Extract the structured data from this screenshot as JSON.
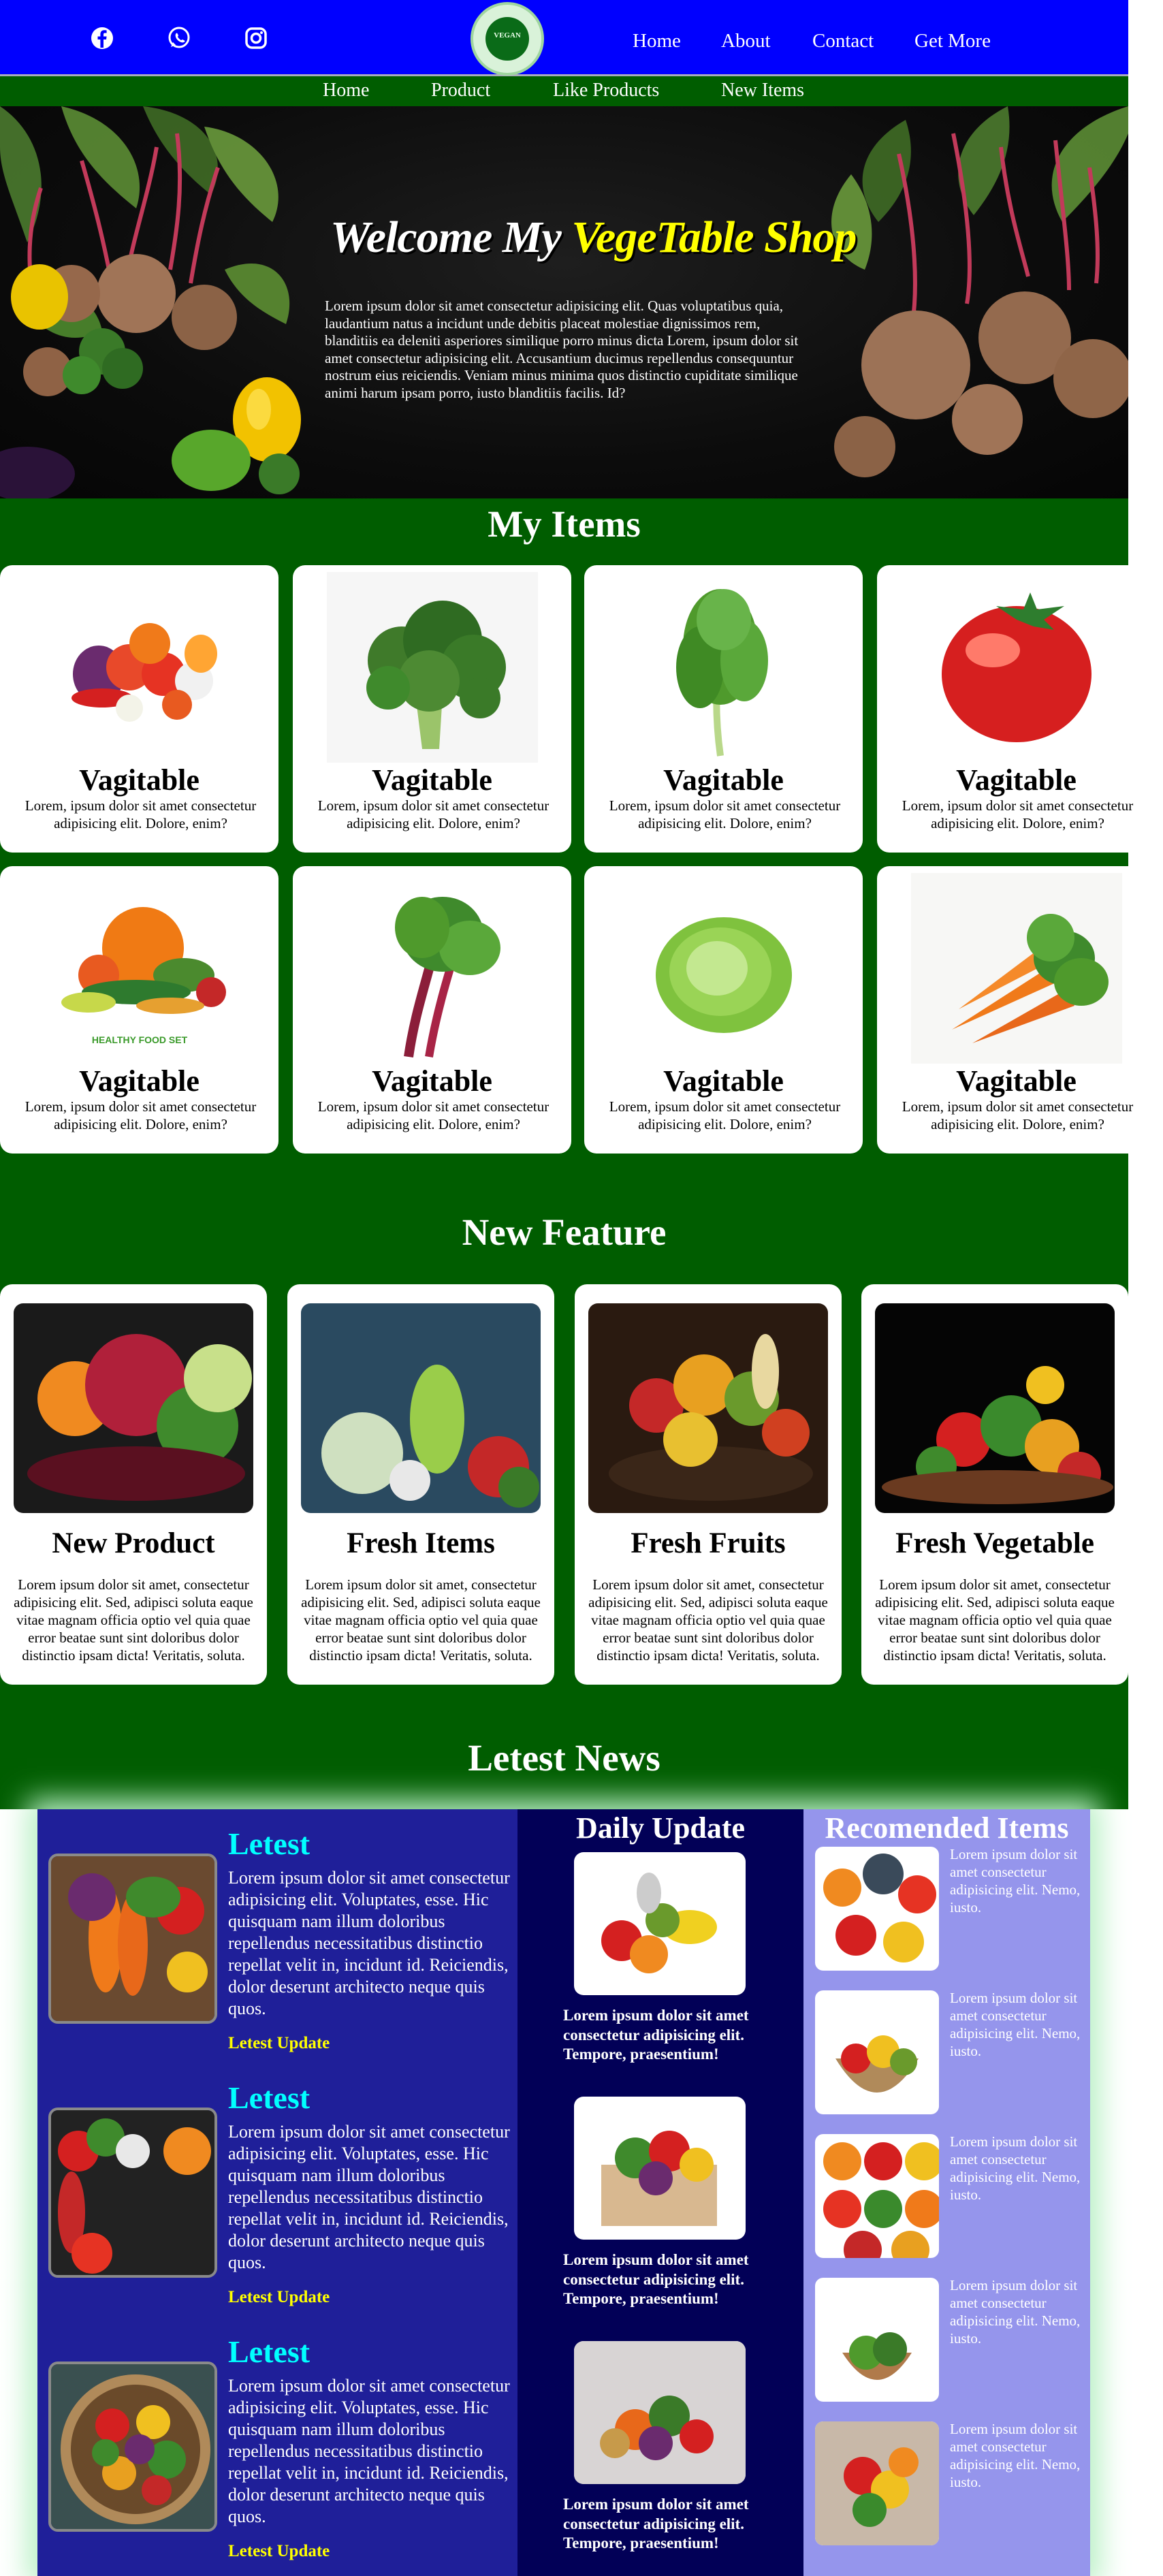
{
  "nav": {
    "social": [
      "facebook-icon",
      "whatsapp-icon",
      "instagram-icon"
    ],
    "logo_text": "VEGAN",
    "links": [
      "Home",
      "About",
      "Contact",
      "Get More"
    ]
  },
  "subnav": {
    "links": [
      "Home",
      "Product",
      "Like Products",
      "New Items"
    ]
  },
  "hero": {
    "title_white": "Welcome My ",
    "title_yellow": "VegeTable Shop",
    "text": "Lorem ipsum dolor sit amet consectetur adipisicing elit. Quas voluptatibus quia, laudantium natus a incidunt unde debitis placeat molestiae dignissimos rem, blanditiis ea deleniti asperiores similique porro minus dicta Lorem, ipsum dolor sit amet consectetur adipisicing elit. Accusantium ducimus repellendus consequuntur nostrum eius reiciendis. Veniam minus minima quos distinctio cupiditate similique animi harum ipsam porro, iusto blanditiis facilis. Id?"
  },
  "my_items": {
    "title": "My Items",
    "items": [
      {
        "name": "Vagitable",
        "desc": "Lorem, ipsum dolor sit amet consectetur adipisicing elit. Dolore, enim?",
        "image": "mixed-vegetables"
      },
      {
        "name": "Vagitable",
        "desc": "Lorem, ipsum dolor sit amet consectetur adipisicing elit. Dolore, enim?",
        "image": "broccoli"
      },
      {
        "name": "Vagitable",
        "desc": "Lorem, ipsum dolor sit amet consectetur adipisicing elit. Dolore, enim?",
        "image": "leafy-greens"
      },
      {
        "name": "Vagitable",
        "desc": "Lorem, ipsum dolor sit amet consectetur adipisicing elit. Dolore, enim?",
        "image": "tomato"
      },
      {
        "name": "Vagitable",
        "desc": "Lorem, ipsum dolor sit amet consectetur adipisicing elit. Dolore, enim?",
        "image": "healthy-food-set"
      },
      {
        "name": "Vagitable",
        "desc": "Lorem, ipsum dolor sit amet consectetur adipisicing elit. Dolore, enim?",
        "image": "chard"
      },
      {
        "name": "Vagitable",
        "desc": "Lorem, ipsum dolor sit amet consectetur adipisicing elit. Dolore, enim?",
        "image": "cabbage"
      },
      {
        "name": "Vagitable",
        "desc": "Lorem, ipsum dolor sit amet consectetur adipisicing elit. Dolore, enim?",
        "image": "carrots"
      }
    ],
    "image_caption": "HEALTHY FOOD SET"
  },
  "new_feature": {
    "title": "New Feature",
    "items": [
      {
        "name": "New Product",
        "desc": "Lorem ipsum dolor sit amet, consectetur adipisicing elit. Sed, adipisci soluta eaque vitae magnam officia optio vel quia quae error beatae sunt sint doloribus dolor distinctio ipsam dicta! Veritatis, soluta."
      },
      {
        "name": "Fresh Items",
        "desc": "Lorem ipsum dolor sit amet, consectetur adipisicing elit. Sed, adipisci soluta eaque vitae magnam officia optio vel quia quae error beatae sunt sint doloribus dolor distinctio ipsam dicta! Veritatis, soluta."
      },
      {
        "name": "Fresh Fruits",
        "desc": "Lorem ipsum dolor sit amet, consectetur adipisicing elit. Sed, adipisci soluta eaque vitae magnam officia optio vel quia quae error beatae sunt sint doloribus dolor distinctio ipsam dicta! Veritatis, soluta."
      },
      {
        "name": "Fresh Vegetable",
        "desc": "Lorem ipsum dolor sit amet, consectetur adipisicing elit. Sed, adipisci soluta eaque vitae magnam officia optio vel quia quae error beatae sunt sint doloribus dolor distinctio ipsam dicta! Veritatis, soluta."
      }
    ]
  },
  "news": {
    "title": "Letest News",
    "left": [
      {
        "title": "Letest",
        "text": "Lorem ipsum dolor sit amet consectetur adipisicing elit. Voluptates, esse. Hic quisquam nam illum doloribus repellendus necessitatibus distinctio repellat velit in, incidunt id. Reiciendis, dolor deserunt architecto neque quis quos.",
        "link": "Letest Update"
      },
      {
        "title": "Letest",
        "text": "Lorem ipsum dolor sit amet consectetur adipisicing elit. Voluptates, esse. Hic quisquam nam illum doloribus repellendus necessitatibus distinctio repellat velit in, incidunt id. Reiciendis, dolor deserunt architecto neque quis quos.",
        "link": "Letest Update"
      },
      {
        "title": "Letest",
        "text": "Lorem ipsum dolor sit amet consectetur adipisicing elit. Voluptates, esse. Hic quisquam nam illum doloribus repellendus necessitatibus distinctio repellat velit in, incidunt id. Reiciendis, dolor deserunt architecto neque quis quos.",
        "link": "Letest Update"
      }
    ],
    "daily": {
      "title": "Daily Update",
      "items": [
        {
          "text": "Lorem ipsum dolor sit amet consectetur adipisicing elit. Tempore, praesentium!"
        },
        {
          "text": "Lorem ipsum dolor sit amet consectetur adipisicing elit. Tempore, praesentium!"
        },
        {
          "text": "Lorem ipsum dolor sit amet consectetur adipisicing elit. Tempore, praesentium!"
        }
      ]
    },
    "recommended": {
      "title": "Recomended Items",
      "items": [
        {
          "text": "Lorem ipsum dolor sit amet consectetur adipisicing elit. Nemo, iusto."
        },
        {
          "text": "Lorem ipsum dolor sit amet consectetur adipisicing elit. Nemo, iusto."
        },
        {
          "text": "Lorem ipsum dolor sit amet consectetur adipisicing elit. Nemo, iusto."
        },
        {
          "text": "Lorem ipsum dolor sit amet consectetur adipisicing elit. Nemo, iusto."
        },
        {
          "text": "Lorem ipsum dolor sit amet consectetur adipisicing elit. Nemo, iusto."
        }
      ]
    }
  },
  "colors": {
    "nav_blue": "#0000ff",
    "green": "#005d00",
    "accent_yellow": "#ffff00",
    "cyan": "#00ffff",
    "news_left": "#1f1f99",
    "news_mid": "#020057",
    "news_right": "#9595ec"
  }
}
